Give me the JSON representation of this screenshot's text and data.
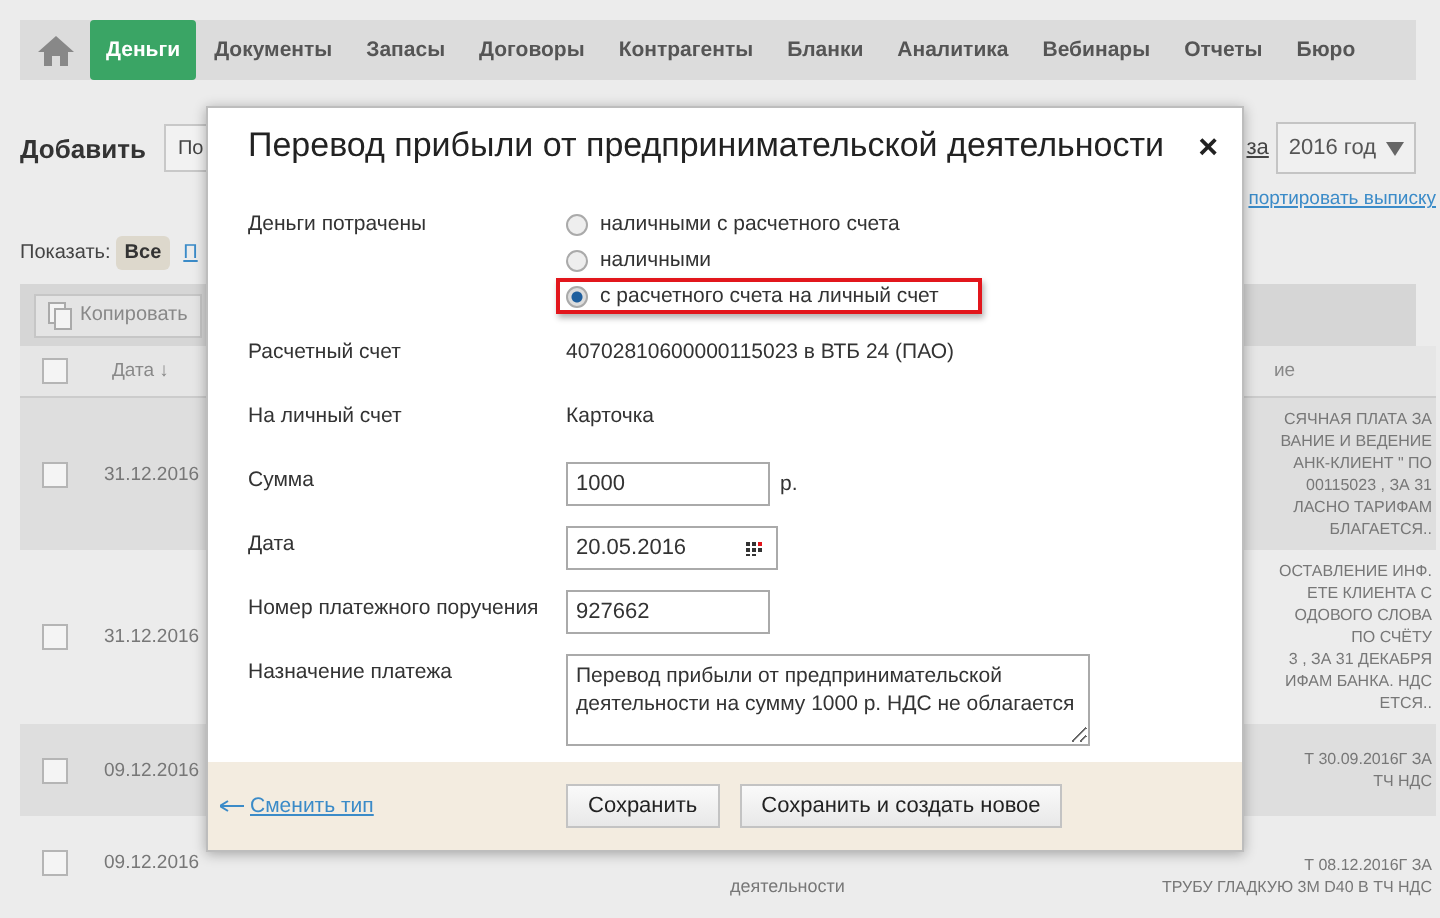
{
  "nav": {
    "items": [
      {
        "label": "Деньги",
        "selected": true
      },
      {
        "label": "Документы",
        "selected": false
      },
      {
        "label": "Запасы",
        "selected": false
      },
      {
        "label": "Договоры",
        "selected": false
      },
      {
        "label": "Контрагенты",
        "selected": false
      },
      {
        "label": "Бланки",
        "selected": false
      },
      {
        "label": "Аналитика",
        "selected": false
      },
      {
        "label": "Вебинары",
        "selected": false
      },
      {
        "label": "Отчеты",
        "selected": false
      },
      {
        "label": "Бюро",
        "selected": false
      }
    ]
  },
  "toolbar": {
    "title": "Добавить",
    "button": "По",
    "period_label": "за",
    "period_select": "2016 год"
  },
  "export_link": "портировать выписку",
  "filter": {
    "label": "Показать:",
    "options": [
      {
        "label": "Все",
        "selected": true
      },
      {
        "label": "П",
        "selected": false
      }
    ]
  },
  "table": {
    "copy_button": "Копировать",
    "header_checked": false,
    "columns": [
      "Дата ↓",
      "ие"
    ],
    "rows": [
      {
        "checked": false,
        "date": "31.12.2016",
        "column_5": [
          "СЯЧНАЯ ПЛАТА ЗА",
          "ВАНИЕ И ВЕДЕНИЕ",
          "АНК-КЛИЕНТ \" ПО",
          "00115023 , ЗА 31",
          "ЛАСНО ТАРИФАМ",
          "БЛАГАЕТСЯ.."
        ]
      },
      {
        "checked": false,
        "date": "31.12.2016",
        "column_5": [
          "ОСТАВЛЕНИЕ ИНФ.",
          "ЕТЕ КЛИЕНТА С",
          "ОДОВОГО СЛОВА",
          "ПО СЧЁТУ",
          "3 , ЗА 31 ДЕКАБРЯ",
          "ИФАМ БАНКА. НДС",
          "ЕТСЯ.."
        ]
      },
      {
        "checked": false,
        "date": "09.12.2016",
        "column_5": [
          "Т 30.09.2016Г ЗА",
          "ТЧ НДС"
        ]
      },
      {
        "checked": false,
        "date": "09.12.2016",
        "column_3": "деятельности",
        "column_5": [
          "Т 08.12.2016Г ЗА",
          "ТРУБУ ГЛАДКУЮ 3М D40 В ТЧ НДС"
        ]
      }
    ]
  },
  "dialog": {
    "title": "Перевод прибыли от предпринимательской деятельности",
    "close": "×",
    "fields": [
      {
        "kind": "radio",
        "label": "Деньги потрачены",
        "options": [
          {
            "label": "наличными с расчетного счета",
            "selected": false,
            "highlighted": false
          },
          {
            "label": "наличными",
            "selected": false,
            "highlighted": false
          },
          {
            "label": "с расчетного счета на личный счет",
            "selected": true,
            "highlighted": true
          }
        ]
      },
      {
        "kind": "text",
        "label": "Расчетный счет",
        "value": "40702810600000115023 в ВТБ 24 (ПАО)"
      },
      {
        "kind": "text",
        "label": "На личный счет",
        "value": "Карточка"
      },
      {
        "kind": "input",
        "label": "Сумма",
        "value": "1000",
        "unit": "р."
      },
      {
        "kind": "date",
        "label": "Дата",
        "value": "20.05.2016"
      },
      {
        "kind": "input",
        "label": "Номер платежного поручения",
        "value": "927662"
      },
      {
        "kind": "textarea",
        "label": "Назначение платежа",
        "value": "Перевод прибыли от предпринимательской деятельности на сумму 1000 р. НДС не облагается"
      }
    ],
    "back_link": "Сменить тип",
    "buttons": [
      "Сохранить",
      "Сохранить и создать новое"
    ]
  }
}
